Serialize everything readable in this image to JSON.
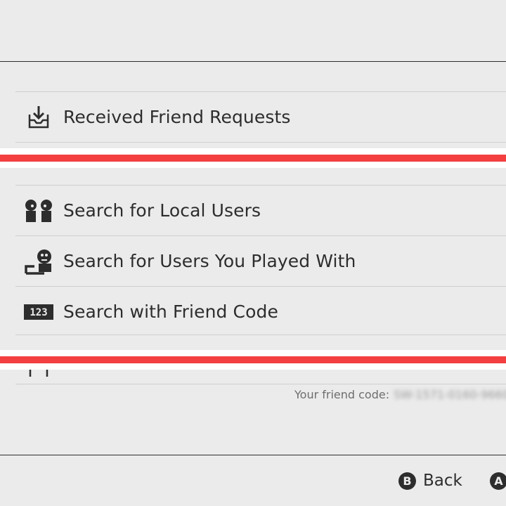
{
  "menu": {
    "received_requests": "Received Friend Requests",
    "search_local": "Search for Local Users",
    "search_played_with": "Search for Users You Played With",
    "search_friend_code": "Search with Friend Code"
  },
  "friend_code": {
    "label": "Your friend code:",
    "value": "SW-1571-0160-9660"
  },
  "footer": {
    "back_key": "B",
    "back_label": "Back",
    "ok_key": "A"
  },
  "icons": {
    "received": "inbox-download-icon",
    "local": "two-users-icon",
    "played_with": "user-played-with-icon",
    "friend_code": "friend-code-123-icon",
    "partial": "upload-icon"
  },
  "colors": {
    "background": "#ebebeb",
    "text": "#2d2d2d",
    "highlight": "#f33f3f"
  }
}
